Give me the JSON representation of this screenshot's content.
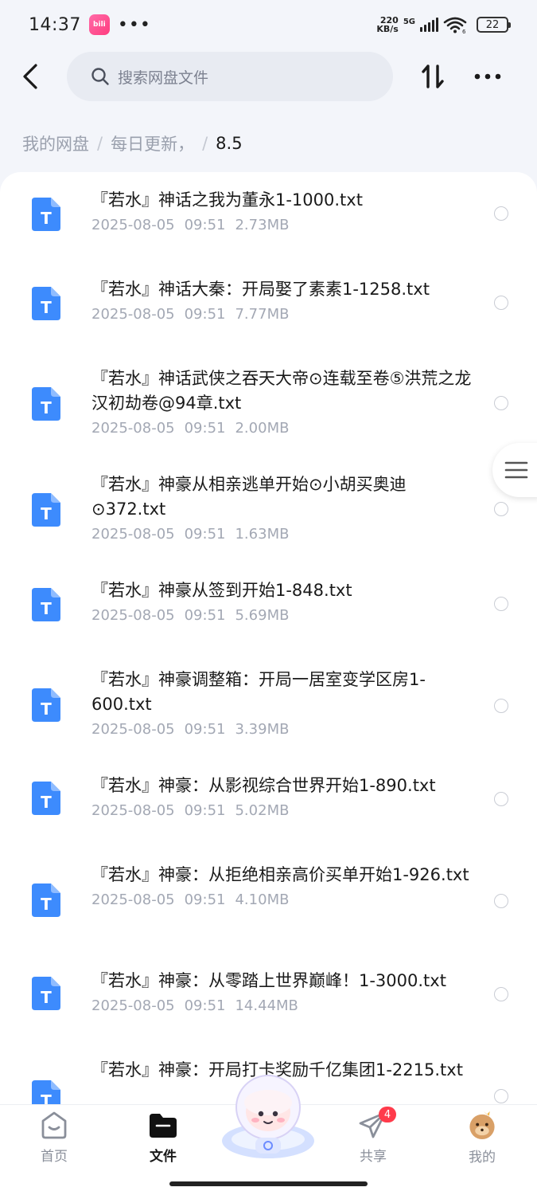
{
  "status_bar": {
    "time": "14:37",
    "app_icon": "bilibili-icon",
    "dots": "•••",
    "net_speed_value": "220",
    "net_speed_unit": "KB/s",
    "network_type": "5G",
    "wifi_label": "6",
    "battery": "22"
  },
  "header": {
    "back_icon": "back-arrow-icon",
    "search_placeholder": "搜索网盘文件",
    "sort_icon": "sort-icon",
    "more_icon": "more-dots-icon"
  },
  "breadcrumb": {
    "items": [
      "我的网盘",
      "每日更新，"
    ],
    "current": "8.5",
    "separator": "/"
  },
  "files": [
    {
      "name": "『若水』神话之我为董永1-1000.txt",
      "date": "2025-08-05",
      "time": "09:51",
      "size": "2.73MB"
    },
    {
      "name": "『若水』神话大秦：开局娶了素素1-1258.txt",
      "date": "2025-08-05",
      "time": "09:51",
      "size": "7.77MB"
    },
    {
      "name": "『若水』神话武侠之吞天大帝⊙连载至卷⑤洪荒之龙汉初劫卷@94章.txt",
      "date": "2025-08-05",
      "time": "09:51",
      "size": "2.00MB"
    },
    {
      "name": "『若水』神豪从相亲逃单开始⊙小胡买奥迪⊙372.txt",
      "date": "2025-08-05",
      "time": "09:51",
      "size": "1.63MB"
    },
    {
      "name": "『若水』神豪从签到开始1-848.txt",
      "date": "2025-08-05",
      "time": "09:51",
      "size": "5.69MB"
    },
    {
      "name": "『若水』神豪调整箱：开局一居室变学区房1-600.txt",
      "date": "2025-08-05",
      "time": "09:51",
      "size": "3.39MB"
    },
    {
      "name": "『若水』神豪：从影视综合世界开始1-890.txt",
      "date": "2025-08-05",
      "time": "09:51",
      "size": "5.02MB"
    },
    {
      "name": "『若水』神豪：从拒绝相亲高价买单开始1-926.txt",
      "date": "2025-08-05",
      "time": "09:51",
      "size": "4.10MB"
    },
    {
      "name": "『若水』神豪：从零踏上世界巅峰！1-3000.txt",
      "date": "2025-08-05",
      "time": "09:51",
      "size": "14.44MB"
    },
    {
      "name": "『若水』神豪：开局打卡奖励千亿集团1-2215.txt",
      "date": "",
      "time": "",
      "size": ""
    }
  ],
  "file_icon_letter": "T",
  "bottom_nav": {
    "items": [
      {
        "label": "首页",
        "icon": "home-icon"
      },
      {
        "label": "文件",
        "icon": "folder-icon"
      },
      {
        "label": "共享",
        "icon": "share-plane-icon",
        "badge": "4"
      },
      {
        "label": "我的",
        "icon": "profile-avatar-icon"
      }
    ],
    "mascot": "astronaut-mascot-icon"
  },
  "colors": {
    "accent_blue": "#3d8bfd",
    "badge_red": "#ff3b4b",
    "meta_gray": "#a3a8b4"
  }
}
